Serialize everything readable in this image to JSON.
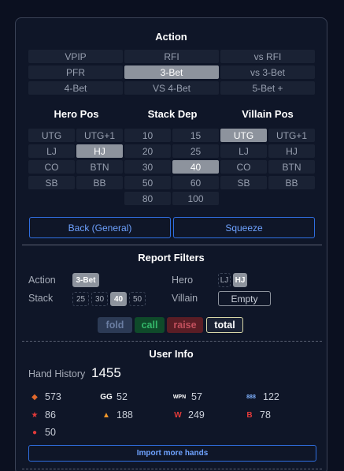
{
  "action": {
    "title": "Action",
    "buttons": [
      {
        "label": "VPIP",
        "active": false
      },
      {
        "label": "RFI",
        "active": false
      },
      {
        "label": "vs RFI",
        "active": false
      },
      {
        "label": "PFR",
        "active": false
      },
      {
        "label": "3-Bet",
        "active": true
      },
      {
        "label": "vs 3-Bet",
        "active": false
      },
      {
        "label": "4-Bet",
        "active": false
      },
      {
        "label": "VS 4-Bet",
        "active": false
      },
      {
        "label": "5-Bet +",
        "active": false
      }
    ]
  },
  "hero_pos": {
    "title": "Hero Pos",
    "buttons": [
      {
        "label": "UTG",
        "active": false
      },
      {
        "label": "UTG+1",
        "active": false
      },
      {
        "label": "LJ",
        "active": false
      },
      {
        "label": "HJ",
        "active": true
      },
      {
        "label": "CO",
        "active": false
      },
      {
        "label": "BTN",
        "active": false
      },
      {
        "label": "SB",
        "active": false
      },
      {
        "label": "BB",
        "active": false
      }
    ]
  },
  "stack_depth": {
    "title": "Stack Dep",
    "buttons": [
      {
        "label": "10",
        "active": false
      },
      {
        "label": "15",
        "active": false
      },
      {
        "label": "20",
        "active": false
      },
      {
        "label": "25",
        "active": false
      },
      {
        "label": "30",
        "active": false
      },
      {
        "label": "40",
        "active": true
      },
      {
        "label": "50",
        "active": false
      },
      {
        "label": "60",
        "active": false
      },
      {
        "label": "80",
        "active": false
      },
      {
        "label": "100",
        "active": false
      }
    ]
  },
  "villain_pos": {
    "title": "Villain Pos",
    "buttons": [
      {
        "label": "UTG",
        "active": true
      },
      {
        "label": "UTG+1",
        "active": false
      },
      {
        "label": "LJ",
        "active": false
      },
      {
        "label": "HJ",
        "active": false
      },
      {
        "label": "CO",
        "active": false
      },
      {
        "label": "BTN",
        "active": false
      },
      {
        "label": "SB",
        "active": false
      },
      {
        "label": "BB",
        "active": false
      }
    ]
  },
  "nav": {
    "back_label": "Back (General)",
    "next_label": "Squeeze"
  },
  "report_filters": {
    "title": "Report Filters",
    "action_label": "Action",
    "action_value": "3-Bet",
    "stack_label": "Stack",
    "stack_chips": [
      {
        "label": "25",
        "active": false
      },
      {
        "label": "30",
        "active": false
      },
      {
        "label": "40",
        "active": true
      },
      {
        "label": "50",
        "active": false
      }
    ],
    "hero_label": "Hero",
    "hero_chips": [
      {
        "label": "LJ",
        "active": false
      },
      {
        "label": "HJ",
        "active": true
      }
    ],
    "villain_label": "Villain",
    "villain_value": "Empty"
  },
  "legend": [
    {
      "label": "fold",
      "bg": "#2c3a55",
      "color": "#6b7ea3",
      "outlined": false
    },
    {
      "label": "call",
      "bg": "#0f4a2a",
      "color": "#34b86a",
      "outlined": false
    },
    {
      "label": "raise",
      "bg": "#5a1d25",
      "color": "#c2505d",
      "outlined": false
    },
    {
      "label": "total",
      "bg": "#1a2234",
      "color": "#ffffff",
      "outlined": true
    }
  ],
  "user_info": {
    "title": "User Info",
    "hand_history_label": "Hand History",
    "hand_history_count": "1455",
    "sites": [
      {
        "icon": "flame-diamond-icon",
        "glyph": "◆",
        "color": "#e0682c",
        "count": "573"
      },
      {
        "icon": "gg-icon",
        "glyph": "GG",
        "color": "#ffffff",
        "count": "52"
      },
      {
        "icon": "wpn-icon",
        "glyph": "WPN",
        "color": "#ffffff",
        "count": "57"
      },
      {
        "icon": "888-icon",
        "glyph": "888",
        "color": "#7fb2ff",
        "count": "122"
      },
      {
        "icon": "pokerstars-icon",
        "glyph": "★",
        "color": "#e23a3a",
        "count": "86"
      },
      {
        "icon": "fire-icon",
        "glyph": "▲",
        "color": "#f0962a",
        "count": "188"
      },
      {
        "icon": "w-brand-icon",
        "glyph": "W",
        "color": "#e23a3a",
        "count": "249"
      },
      {
        "icon": "b-brand-icon",
        "glyph": "B",
        "color": "#e23a3a",
        "count": "78"
      },
      {
        "icon": "chip-icon",
        "glyph": "●",
        "color": "#e23a3a",
        "count": "50"
      }
    ],
    "import_label": "Import more hands"
  }
}
